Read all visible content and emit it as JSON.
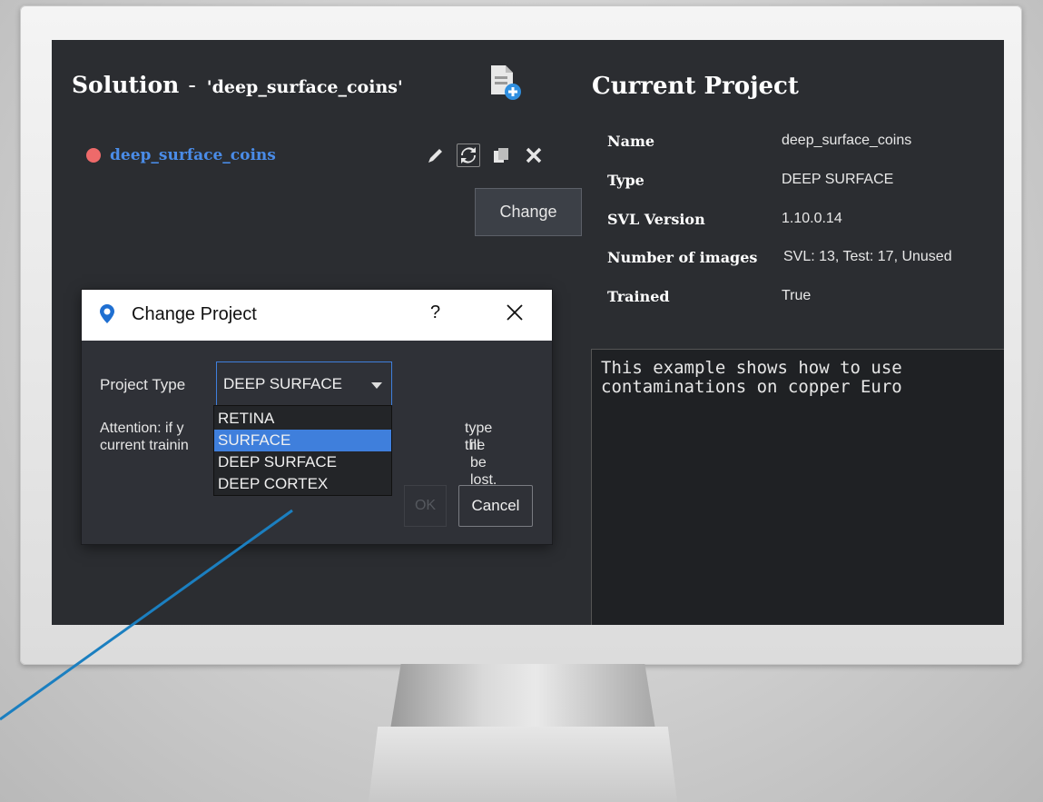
{
  "solution": {
    "title": "Solution",
    "separator": "-",
    "project_quoted": "'deep_surface_coins'",
    "project_name": "deep_surface_coins"
  },
  "tooltip": "Change",
  "current_project": {
    "title": "Current Project",
    "rows": [
      {
        "key": "Name",
        "value": "deep_surface_coins"
      },
      {
        "key": "Type",
        "value": "DEEP SURFACE"
      },
      {
        "key": "SVL Version",
        "value": "1.10.0.14"
      },
      {
        "key": "Number of images",
        "value": "SVL: 13, Test: 17, Unused"
      },
      {
        "key": "Trained",
        "value": "True"
      }
    ],
    "description": "This example shows how to use\ncontaminations on copper Euro"
  },
  "dialog": {
    "title": "Change Project",
    "help": "?",
    "project_type_label": "Project Type",
    "project_type_value": "DEEP SURFACE",
    "attention_line1": "Attention: if y",
    "attention_line1_end": "type the",
    "attention_line2": "current trainin",
    "attention_line2_end": "ill be lost.",
    "ok_label": "OK",
    "cancel_label": "Cancel",
    "options": [
      "RETINA",
      "SURFACE",
      "DEEP SURFACE",
      "DEEP CORTEX"
    ],
    "highlighted_option": "SURFACE"
  },
  "colors": {
    "screen_bg": "#2b2d31",
    "accent_blue": "#3f7fdc",
    "project_link": "#4a8ce8",
    "status_dot": "#ee6a6a",
    "pointer_line": "#1b7fc0"
  },
  "icons": [
    "add-file-icon",
    "edit-icon",
    "change-icon",
    "copy-icon",
    "delete-icon",
    "location-pin-icon",
    "close-icon"
  ]
}
